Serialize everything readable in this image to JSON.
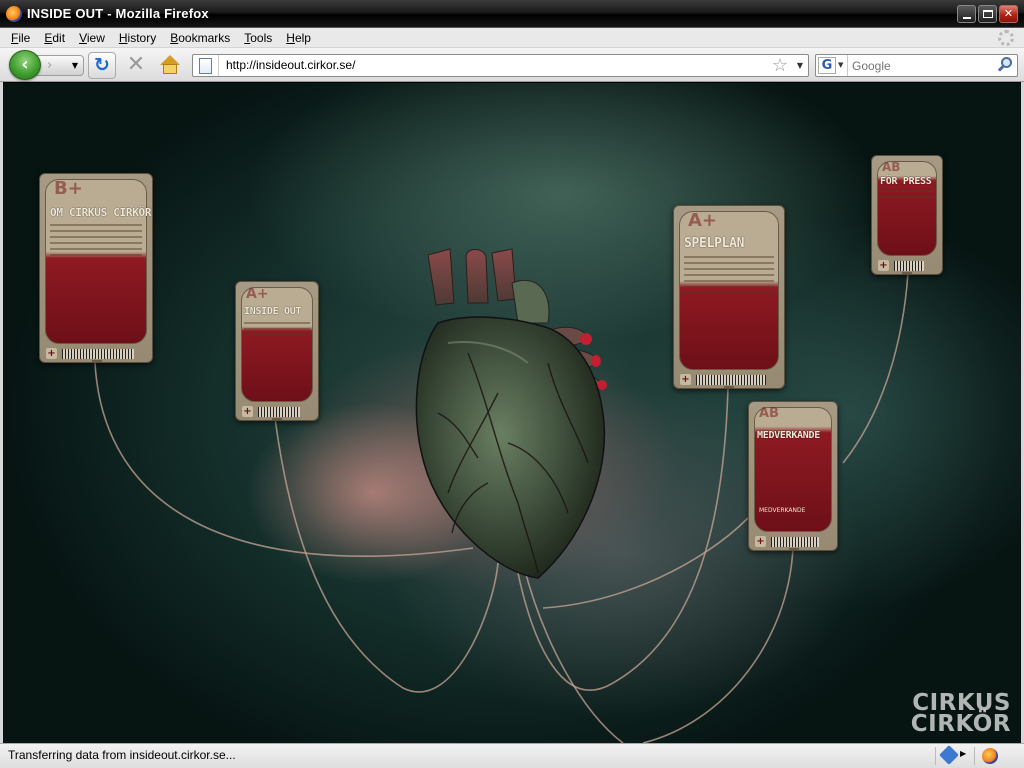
{
  "window": {
    "title": "INSIDE OUT - Mozilla Firefox"
  },
  "menu": {
    "items": [
      {
        "label": "File",
        "mnemonic": "F",
        "rest": "ile"
      },
      {
        "label": "Edit",
        "mnemonic": "E",
        "rest": "dit"
      },
      {
        "label": "View",
        "mnemonic": "V",
        "rest": "iew"
      },
      {
        "label": "History",
        "mnemonic": "H",
        "rest": "istory"
      },
      {
        "label": "Bookmarks",
        "mnemonic": "B",
        "rest": "ookmarks"
      },
      {
        "label": "Tools",
        "mnemonic": "T",
        "rest": "ools"
      },
      {
        "label": "Help",
        "mnemonic": "H",
        "rest": "elp"
      }
    ]
  },
  "toolbar": {
    "url": "http://insideout.cirkor.se/",
    "search_placeholder": "Google",
    "search_engine_letter": "G"
  },
  "page": {
    "bags": [
      {
        "id": "om-cirkus",
        "blood_type": "B+",
        "title": "OM CIRKUS CIRKÖR"
      },
      {
        "id": "inside-out",
        "blood_type": "A+",
        "title": "INSIDE OUT"
      },
      {
        "id": "spelplan",
        "blood_type": "A+",
        "title": "SPELPLAN"
      },
      {
        "id": "for-press",
        "blood_type": "AB",
        "title": "FÖR PRESS"
      },
      {
        "id": "medverkande",
        "blood_type": "AB",
        "title": "MEDVERKANDE",
        "subtitle": "MEDVERKANDE"
      }
    ],
    "brand_line1": "CIRKUS",
    "brand_line2": "CIRKÖR"
  },
  "status": {
    "text": "Transferring data from insideout.cirkor.se..."
  },
  "colors": {
    "blood": "#7a1220",
    "bag_plastic": "#b9ac93",
    "background_dark": "#0b1d1a"
  },
  "icons": {
    "back": "back-arrow-icon",
    "forward": "forward-arrow-icon",
    "reload": "reload-icon",
    "stop": "stop-icon",
    "home": "home-icon",
    "bookmark_star": "star-icon",
    "search_go": "magnifier-icon"
  }
}
